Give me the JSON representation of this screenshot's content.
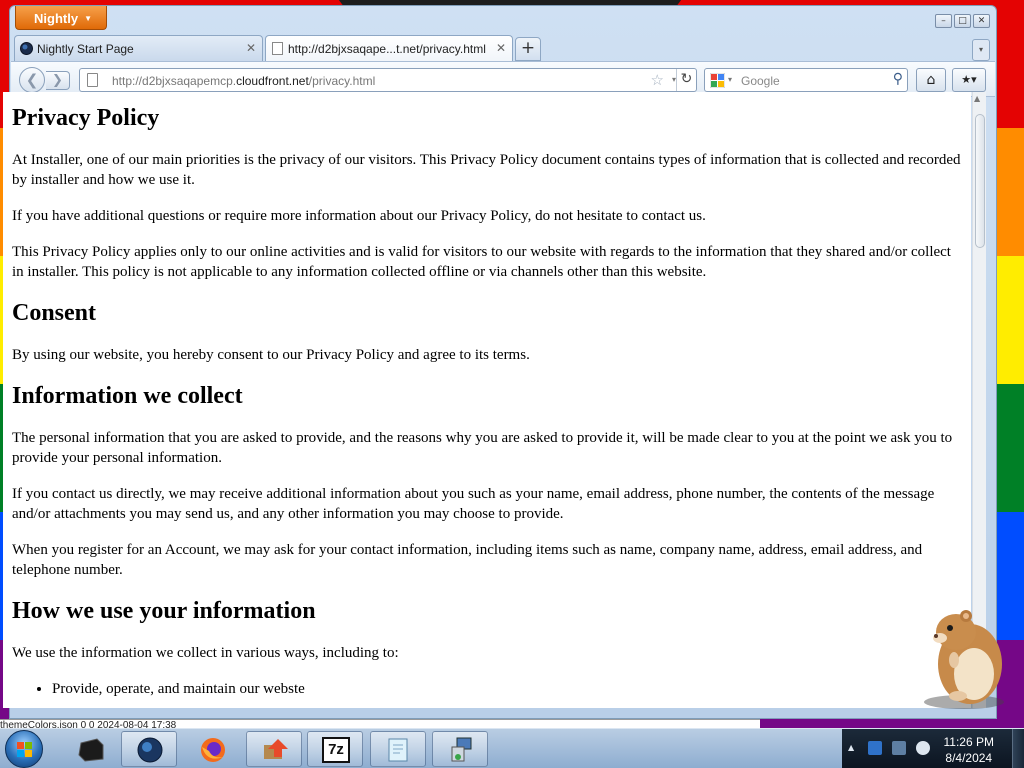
{
  "app_button": {
    "label": "Nightly"
  },
  "window_controls": {
    "minimize": "–",
    "maximize": "□",
    "close": "✕"
  },
  "tabs": [
    {
      "label": "Nightly Start Page",
      "close": "✕"
    },
    {
      "label": "http://d2bjxsaqape...t.net/privacy.html",
      "close": "✕"
    }
  ],
  "new_tab": {
    "label": "+"
  },
  "tab_list": {
    "label": "▾"
  },
  "navbar": {
    "back": "❮",
    "forward": "❯",
    "url_prefix": "http://d2bjxsaqapemcp.",
    "url_host": "cloudfront.net",
    "url_path": "/privacy.html",
    "bookmark_star": "☆",
    "url_dropdown": "▾",
    "reload": "↻",
    "search_engine_dropdown": "▾",
    "search_placeholder": "Google",
    "search_glass": "⚲",
    "home": "⌂",
    "bookmarks_menu": "★▾"
  },
  "page": {
    "h1": "Privacy Policy",
    "p1": "At Installer, one of our main priorities is the privacy of our visitors. This Privacy Policy document contains types of information that is collected and recorded by installer and how we use it.",
    "p2": "If you have additional questions or require more information about our Privacy Policy, do not hesitate to contact us.",
    "p3": "This Privacy Policy applies only to our online activities and is valid for visitors to our website with regards to the information that they shared and/or collect in installer. This policy is not applicable to any information collected offline or via channels other than this website.",
    "h2_consent": "Consent",
    "p4": "By using our website, you hereby consent to our Privacy Policy and agree to its terms.",
    "h2_collect": "Information we collect",
    "p5": "The personal information that you are asked to provide, and the reasons why you are asked to provide it, will be made clear to you at the point we ask you to provide your personal information.",
    "p6": "If you contact us directly, we may receive additional information about you such as your name, email address, phone number, the contents of the message and/or attachments you may send us, and any other information you may choose to provide.",
    "p7": "When you register for an Account, we may ask for your contact information, including items such as name, company name, address, email address, and telephone number.",
    "h2_use": "How we use your information",
    "p8": "We use the information we collect in various ways, including to:",
    "list": [
      "Provide, operate, and maintain our webste"
    ]
  },
  "scrollbar": {
    "up": "▲"
  },
  "background_window": {
    "row": "themeColors.json                    0                    0     2024-08-04 17:38"
  },
  "taskbar": {
    "items": [
      "terminal",
      "nightly",
      "firefox",
      "installer",
      "7-zip",
      "notepad",
      "setup"
    ],
    "seven_zip_label": "7z",
    "show_hidden": "▲"
  },
  "clock": {
    "time": "11:26 PM",
    "date": "8/4/2024"
  },
  "colors": {
    "flag": [
      "#e40303",
      "#ff8c00",
      "#ffed00",
      "#008026",
      "#004dff",
      "#750787"
    ],
    "accent": "#e06a08"
  }
}
